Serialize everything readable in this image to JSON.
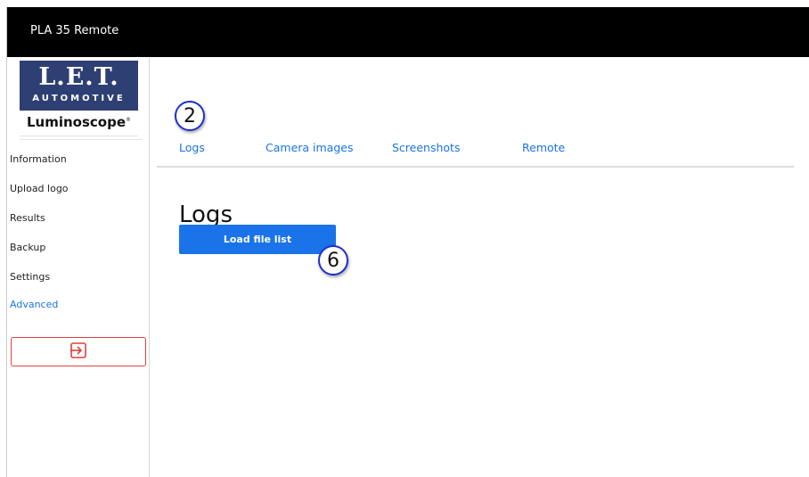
{
  "window": {
    "title": "PLA 35 Remote"
  },
  "logo": {
    "brand": "L.E.T.",
    "subbrand": "AUTOMOTIVE",
    "product": "Luminoscope",
    "trademark": "®",
    "brand_color": "#2e3f73"
  },
  "sidebar": {
    "items": [
      {
        "label": "Information",
        "active": false
      },
      {
        "label": "Upload logo",
        "active": false
      },
      {
        "label": "Results",
        "active": false
      },
      {
        "label": "Backup",
        "active": false
      },
      {
        "label": "Settings",
        "active": false
      },
      {
        "label": "Advanced",
        "active": true
      }
    ],
    "logout": {
      "icon": "logout-icon",
      "color": "#e04040"
    }
  },
  "annotations": [
    {
      "label": "2"
    },
    {
      "label": "6"
    }
  ],
  "tabs": [
    {
      "label": "Logs"
    },
    {
      "label": "Camera images"
    },
    {
      "label": "Screenshots"
    },
    {
      "label": "Remote"
    }
  ],
  "main": {
    "heading": "Logs",
    "load_button": "Load file list"
  },
  "colors": {
    "accent": "#1a73e8",
    "titlebar": "#000000",
    "marker_ring": "#1f2fd0"
  }
}
